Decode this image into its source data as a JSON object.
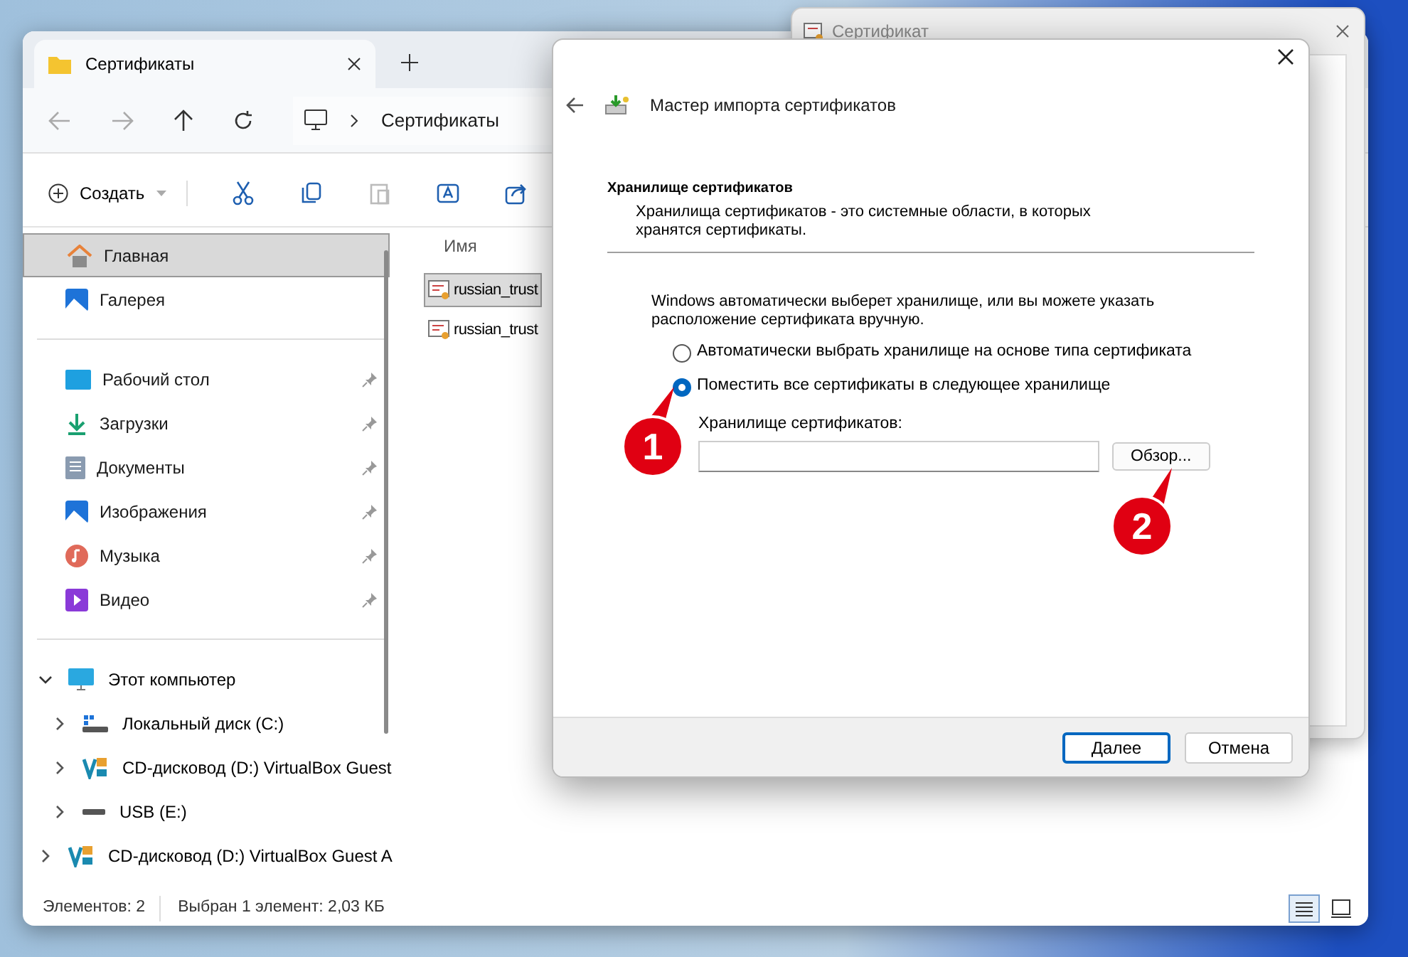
{
  "explorer": {
    "tab": {
      "title": "Сертификаты"
    },
    "breadcrumb": "Сертификаты",
    "toolbar": {
      "new_label": "Создать"
    },
    "nav": {
      "quick": [
        {
          "label": "Главная",
          "selected": true
        },
        {
          "label": "Галерея",
          "selected": false
        }
      ],
      "pinned": [
        {
          "label": "Рабочий стол"
        },
        {
          "label": "Загрузки"
        },
        {
          "label": "Документы"
        },
        {
          "label": "Изображения"
        },
        {
          "label": "Музыка"
        },
        {
          "label": "Видео"
        }
      ],
      "tree": [
        {
          "label": "Этот компьютер",
          "expanded": true,
          "children": [
            {
              "label": "Локальный диск (C:)"
            },
            {
              "label": "CD-дисковод (D:) VirtualBox Guest"
            },
            {
              "label": "USB (E:)"
            }
          ]
        },
        {
          "label": "CD-дисковод (D:) VirtualBox Guest A",
          "expanded": false
        }
      ]
    },
    "files": {
      "column_1": "Имя",
      "rows": [
        {
          "name": "russian_trust",
          "selected": true
        },
        {
          "name": "russian_trust",
          "selected": false
        }
      ]
    },
    "status_bar": {
      "count": "Элементов: 2",
      "selection": "Выбран 1 элемент: 2,03 КБ"
    },
    "view_buttons": [
      {
        "kind": "details",
        "selected": true
      },
      {
        "kind": "tiles",
        "selected": false
      }
    ]
  },
  "background_window": {
    "title": "Сертификат"
  },
  "dialog": {
    "title": "Мастер импорта сертификатов",
    "section_title": "Хранилище сертификатов",
    "section_description": "Хранилища сертификатов - это системные области, в которых хранятся сертификаты.",
    "intro": "Windows автоматически выберет хранилище, или вы можете указать расположение сертификата вручную.",
    "options": [
      {
        "label": "Автоматически выбрать хранилище на основе типа сертификата",
        "selected": false
      },
      {
        "label": "Поместить все сертификаты в следующее хранилище",
        "selected": true
      }
    ],
    "store_label": "Хранилище сертификатов:",
    "browse_button": "Обзор...",
    "buttons": [
      {
        "label": "Далее",
        "kind": "primary"
      },
      {
        "label": "Отмена",
        "kind": "secondary"
      }
    ]
  },
  "callouts": [
    "1",
    "2"
  ]
}
